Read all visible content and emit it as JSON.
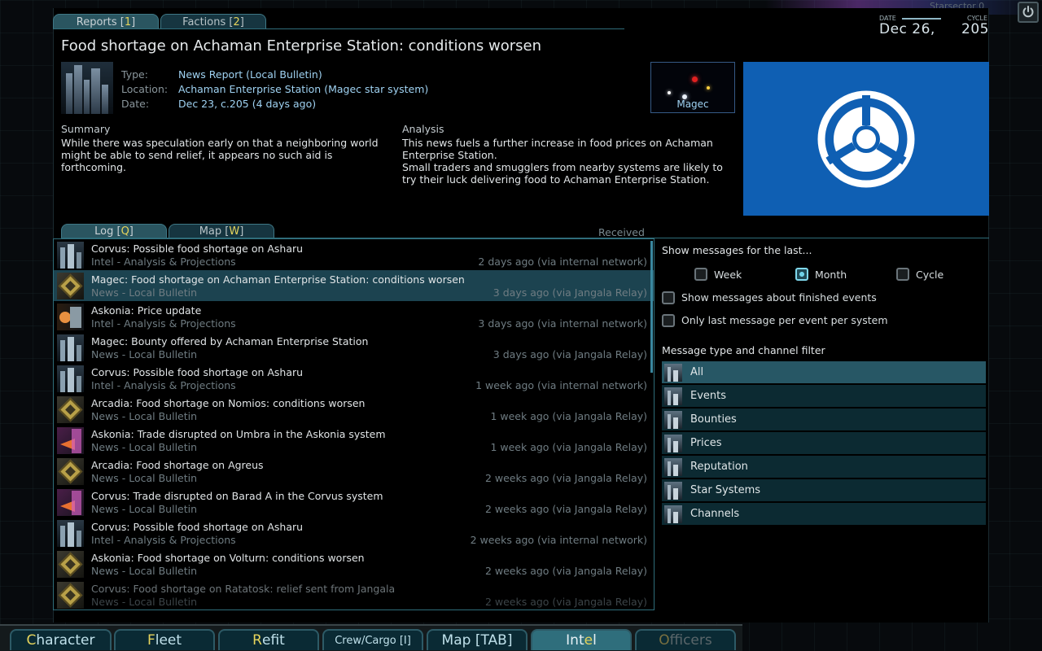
{
  "window": {
    "brand_text": "Starsector 0",
    "date_label": "DATE",
    "date_value": "Dec 26,",
    "cycle_label": "CYCLE",
    "cycle_value": "205"
  },
  "top_tabs": [
    {
      "label": "Reports",
      "hotkey": "1"
    },
    {
      "label": "Factions",
      "hotkey": "2"
    }
  ],
  "report": {
    "headline": "Food shortage on Achaman Enterprise Station: conditions worsen",
    "type_key": "Type:",
    "type_val": "News Report (Local Bulletin)",
    "location_key": "Location:",
    "location_val": "Achaman Enterprise Station  (Magec star system)",
    "date_key": "Date:",
    "date_val": "Dec 23, c.205 (4 days ago)",
    "map_label": "Magec",
    "summary_title": "Summary",
    "summary_text": "While there was speculation early on that a neighboring world might be able to send relief, it appears no such aid is forthcoming.",
    "analysis_title": "Analysis",
    "analysis_line1": "This news fuels a further increase in food prices on Achaman Enterprise Station.",
    "analysis_line2": "Small traders and smugglers from nearby systems are likely to try their luck delivering food to Achaman Enterprise Station.",
    "flag_color": "#0f5fb3"
  },
  "log_tabs": [
    {
      "label": "Log",
      "hotkey": "Q"
    },
    {
      "label": "Map",
      "hotkey": "W"
    }
  ],
  "received_label": "Received",
  "messages": [
    {
      "title": "Corvus: Possible food shortage on Asharu",
      "sub": "Intel - Analysis & Projections",
      "time": "2 days ago (via internal network)",
      "icon": "city"
    },
    {
      "title": "Magec: Food shortage on Achaman Enterprise Station: conditions worsen",
      "sub": "News - Local Bulletin",
      "time": "3 days ago (via Jangala Relay)",
      "icon": "crate"
    },
    {
      "title": "Askonia: Price update",
      "sub": "Intel - Analysis & Projections",
      "time": "3 days ago (via internal network)",
      "icon": "price"
    },
    {
      "title": "Magec: Bounty offered by Achaman Enterprise Station",
      "sub": "News - Local Bulletin",
      "time": "3 days ago (via Jangala Relay)",
      "icon": "city"
    },
    {
      "title": "Corvus: Possible food shortage on Asharu",
      "sub": "Intel - Analysis & Projections",
      "time": "1 week ago (via internal network)",
      "icon": "city"
    },
    {
      "title": "Arcadia: Food shortage on Nomios: conditions worsen",
      "sub": "News - Local Bulletin",
      "time": "1 week ago (via Jangala Relay)",
      "icon": "crate"
    },
    {
      "title": "Askonia: Trade disrupted on Umbra in the Askonia system",
      "sub": "News - Local Bulletin",
      "time": "1 week ago (via Jangala Relay)",
      "icon": "trade"
    },
    {
      "title": "Arcadia: Food shortage on Agreus",
      "sub": "News - Local Bulletin",
      "time": "2 weeks ago (via Jangala Relay)",
      "icon": "crate"
    },
    {
      "title": "Corvus: Trade disrupted on Barad A in the Corvus system",
      "sub": "News - Local Bulletin",
      "time": "2 weeks ago (via Jangala Relay)",
      "icon": "trade"
    },
    {
      "title": "Corvus: Possible food shortage on Asharu",
      "sub": "Intel - Analysis & Projections",
      "time": "2 weeks ago (via internal network)",
      "icon": "city"
    },
    {
      "title": "Askonia: Food shortage on Volturn: conditions worsen",
      "sub": "News - Local Bulletin",
      "time": "2 weeks ago (via Jangala Relay)",
      "icon": "crate"
    },
    {
      "title": "Corvus: Food shortage on Ratatosk: relief sent from Jangala",
      "sub": "News - Local Bulletin",
      "time": "2 weeks ago (via Jangala Relay)",
      "icon": "crate"
    }
  ],
  "filters": {
    "show_title": "Show messages for the last...",
    "periods": [
      {
        "label": "Week",
        "checked": false
      },
      {
        "label": "Month",
        "checked": true
      },
      {
        "label": "Cycle",
        "checked": false
      }
    ],
    "finished_label": "Show messages about finished events",
    "last_only_label": "Only last message per event per system",
    "type_title": "Message type and channel filter",
    "types": [
      "All",
      "Events",
      "Bounties",
      "Prices",
      "Reputation",
      "Star Systems",
      "Channels"
    ]
  },
  "bottom_tabs": [
    {
      "label": "Character",
      "hk": "C",
      "rest": "haracter"
    },
    {
      "label": "Fleet",
      "hk": "F",
      "rest": "leet"
    },
    {
      "label": "Refit",
      "hk": "R",
      "rest": "efit"
    },
    {
      "label": "Crew/Cargo [I]"
    },
    {
      "label": "Map [TAB]"
    },
    {
      "label": "Intel",
      "pre": "Int",
      "hk": "e",
      "rest": "l"
    },
    {
      "label": "Officers",
      "hk": "O",
      "rest": "fficers"
    }
  ]
}
